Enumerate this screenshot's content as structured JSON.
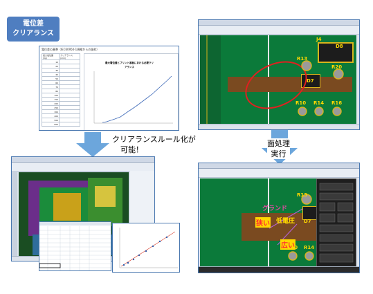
{
  "badge": {
    "line1": "電位差",
    "line2": "クリアランス"
  },
  "chart_panel": {
    "sheet_title": "電位差の基準（IEC60950-1規格からの抜粋）",
    "col_headers": [
      "最大電位差 (Vp)",
      "クリアランス (mm)"
    ],
    "values_v": [
      10,
      20,
      30,
      40,
      50,
      60,
      70,
      80,
      100,
      150,
      200,
      250,
      300,
      400,
      500,
      600
    ],
    "chart_title": "最大電位差とプリント基板における必要クリアランス"
  },
  "arrow_left": {
    "caption_line1": "クリアランスルール化が",
    "caption_line2": "可能！"
  },
  "arrow_right": {
    "caption_line1": "面処理",
    "caption_line2": "実行"
  },
  "top_right_screen": {
    "labels": [
      "J4",
      "D8",
      "R13",
      "R20",
      "D7",
      "R10",
      "R14",
      "R16"
    ]
  },
  "bottom_right_screen": {
    "labels": [
      "R13",
      "D7",
      "R10",
      "R14"
    ],
    "callouts": {
      "ground": "グランド",
      "narrow": "狭い",
      "low_voltage": "低電圧",
      "wide": "広い"
    }
  },
  "colors": {
    "badge": "#4f7ec0",
    "arrow": "#6ca6dc",
    "pcb": "#0b7a3a",
    "pad": "#d9b51c",
    "trace_red": "#c0392b",
    "callout_yellow": "#ffd800",
    "callout_magenta": "#e64ba6"
  }
}
